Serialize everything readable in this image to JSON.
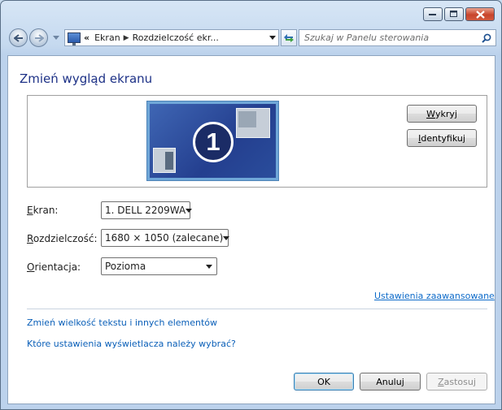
{
  "window": {
    "controls": {
      "minimize_icon": "minimize-icon",
      "maximize_icon": "maximize-icon",
      "close_icon": "close-icon"
    }
  },
  "nav": {
    "breadcrumbs": [
      "Ekran",
      "Rozdzielczość ekr..."
    ],
    "overflow_chevron": "«",
    "search_placeholder": "Szukaj w Panelu sterowania"
  },
  "page": {
    "title": "Zmień wygląd ekranu",
    "preview": {
      "monitor_number": "1",
      "detect_button": {
        "pre": "",
        "accel": "W",
        "post": "ykryj"
      },
      "identify_button": {
        "pre": "",
        "accel": "I",
        "post": "dentyfikuj"
      }
    },
    "fields": {
      "screen": {
        "label_accel": "E",
        "label_rest": "kran:",
        "value": "1. DELL 2209WA"
      },
      "resolution": {
        "label_accel": "R",
        "label_rest": "ozdzielczość:",
        "value": "1680 × 1050 (zalecane)"
      },
      "orientation": {
        "label_accel": "O",
        "label_rest": "rientacja:",
        "value": "Pozioma"
      }
    },
    "advanced_link": "Ustawienia zaawansowane",
    "links": [
      "Zmień wielkość tekstu i innych elementów",
      "Które ustawienia wyświetlacza należy wybrać?"
    ],
    "buttons": {
      "ok": "OK",
      "cancel": "Anuluj",
      "apply": {
        "accel": "Z",
        "rest": "astosuj",
        "disabled": true
      }
    }
  },
  "colors": {
    "title": "#1e3287",
    "link": "#0a5fb8",
    "accent": "#3c7fb1"
  }
}
